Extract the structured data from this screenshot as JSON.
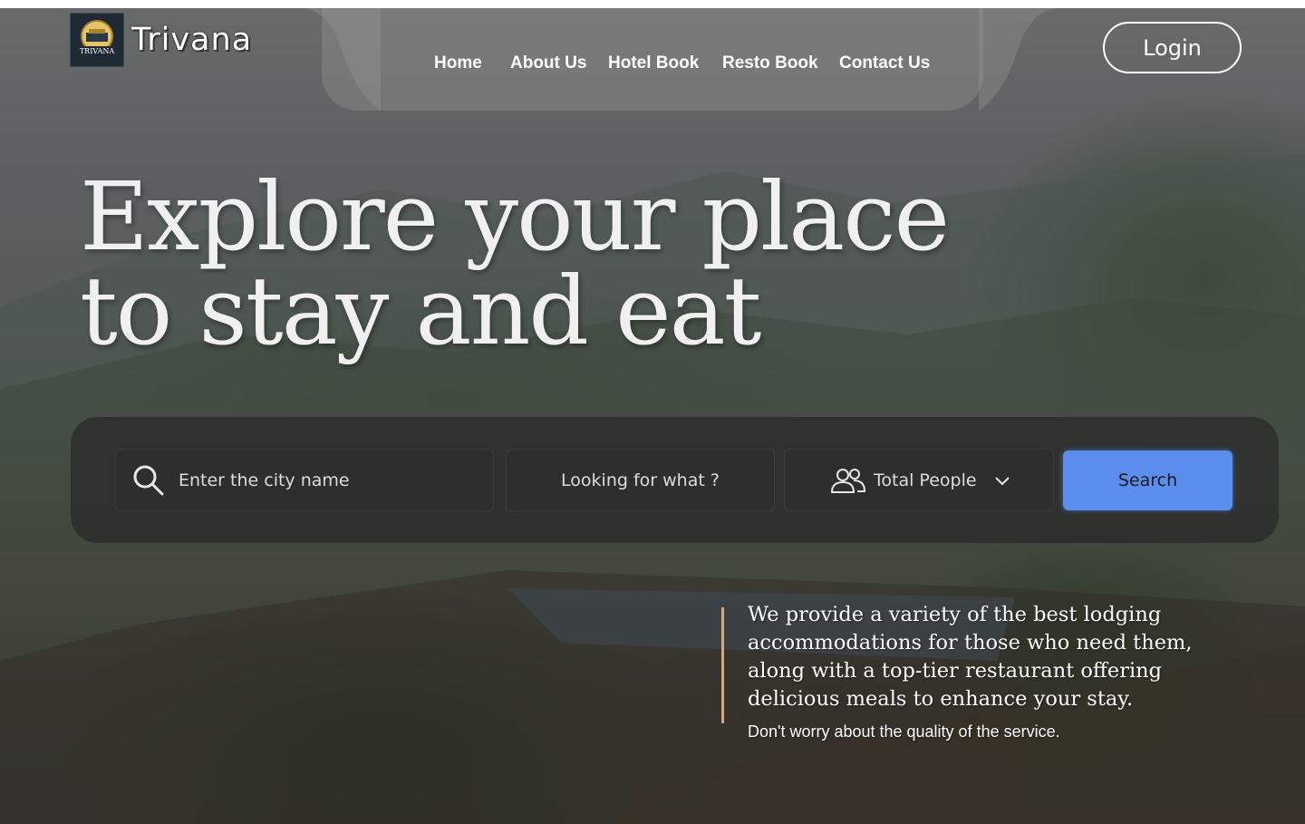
{
  "brand": {
    "name": "Trivana",
    "logo_text": "TRIVANA"
  },
  "nav": {
    "items": [
      {
        "label": "Home"
      },
      {
        "label": "About Us"
      },
      {
        "label": "Hotel Book"
      },
      {
        "label": "Resto Book"
      },
      {
        "label": "Contact Us"
      }
    ],
    "login_label": "Login"
  },
  "hero": {
    "headline_line1": "Explore your place",
    "headline_line2": "to stay and eat"
  },
  "search": {
    "city_placeholder": "Enter the city name",
    "what_placeholder": "Looking for what ?",
    "people_label": "Total People",
    "button_label": "Search",
    "icons": {
      "city": "search-icon",
      "people": "people-icon",
      "dropdown": "chevron-down-icon"
    }
  },
  "tagline": {
    "main": "We provide a variety of the best lodging accommodations for those who need them, along with a top-tier restaurant offering delicious meals to enhance your stay.",
    "sub": "Don't worry about the quality of the service."
  },
  "colors": {
    "accent": "#5b8def",
    "bar": "#d6a77a"
  }
}
